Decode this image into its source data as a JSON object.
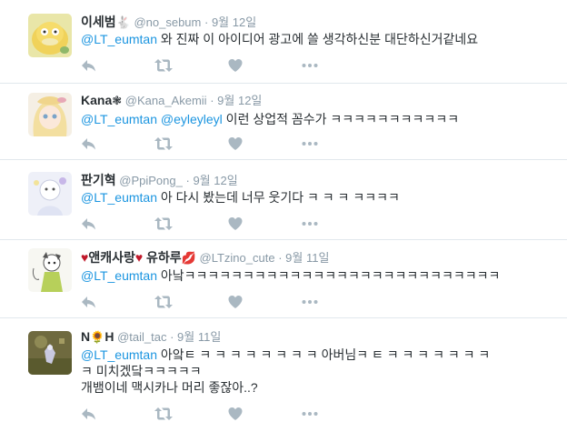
{
  "tweets": [
    {
      "fullname": "이세범",
      "name_suffix": "🐇",
      "handle": "@no_sebum",
      "sep": "·",
      "time": "9월 12일",
      "mention": "@LT_eumtan",
      "lines": [
        " 와 진짜 이 아이디어 광고에 쓸 생각하신분 대단하신거같네요"
      ]
    },
    {
      "fullname": "Kana",
      "name_suffix": "❃",
      "handle": "@Kana_Akemii",
      "sep": "·",
      "time": "9월 12일",
      "mention": "@LT_eumtan",
      "mention2": "@eyleyleyl",
      "lines": [
        " 이런 상업적 꼼수가 ㅋㅋㅋㅋㅋㅋㅋㅋㅋㅋㅋ"
      ]
    },
    {
      "fullname": "판기혁",
      "name_suffix": "",
      "handle": "@PpiPong_",
      "sep": "·",
      "time": "9월 12일",
      "mention": "@LT_eumtan",
      "lines": [
        " 아 다시 봤는데 너무 웃기다 ㅋ ㅋ ㅋ ㅋㅋㅋㅋ"
      ]
    },
    {
      "name_prefix": "♥",
      "fullname": "앤캐사랑",
      "name_mid": "♥",
      "fullname2": " 유하루",
      "name_suffix": "💋",
      "handle": "@LTzino_cute",
      "sep": "·",
      "time": "9월 11일",
      "mention": "@LT_eumtan",
      "lines": [
        " 아낰ㅋㅋㅋㅋㅋㅋㅋㅋㅋㅋㅋㅋㅋㅋㅋㅋㅋㅋㅋㅋㅋㅋㅋㅋㅋㅋㅋ"
      ]
    },
    {
      "fullname": "N",
      "name_mid": "🌻",
      "fullname2": "H",
      "name_suffix": "",
      "handle": "@tail_tac",
      "sep": "·",
      "time": "9월 11일",
      "mention": "@LT_eumtan",
      "lines": [
        " 아앜ㅌ ㅋ ㅋ ㅋ ㅋ ㅋ ㅋ ㅋ ㅋ  아버님ㅋ ㅌ ㅋ ㅋ ㅋ ㅋ ㅋ ㅋ ㅋ",
        "ㅋ 미치겠닼ㅋㅋㅋㅋㅋ",
        "개뱀이네 맥시카나 머리 좋잖아..?"
      ]
    }
  ],
  "icons": {
    "reply": "reply-icon",
    "retweet": "retweet-icon",
    "like": "heart-icon",
    "more": "more-icon"
  },
  "colors": {
    "mention": "#1b95e0",
    "meta": "#8899a6",
    "action_icon": "#aab8c2",
    "divider": "#e1e8ed"
  }
}
